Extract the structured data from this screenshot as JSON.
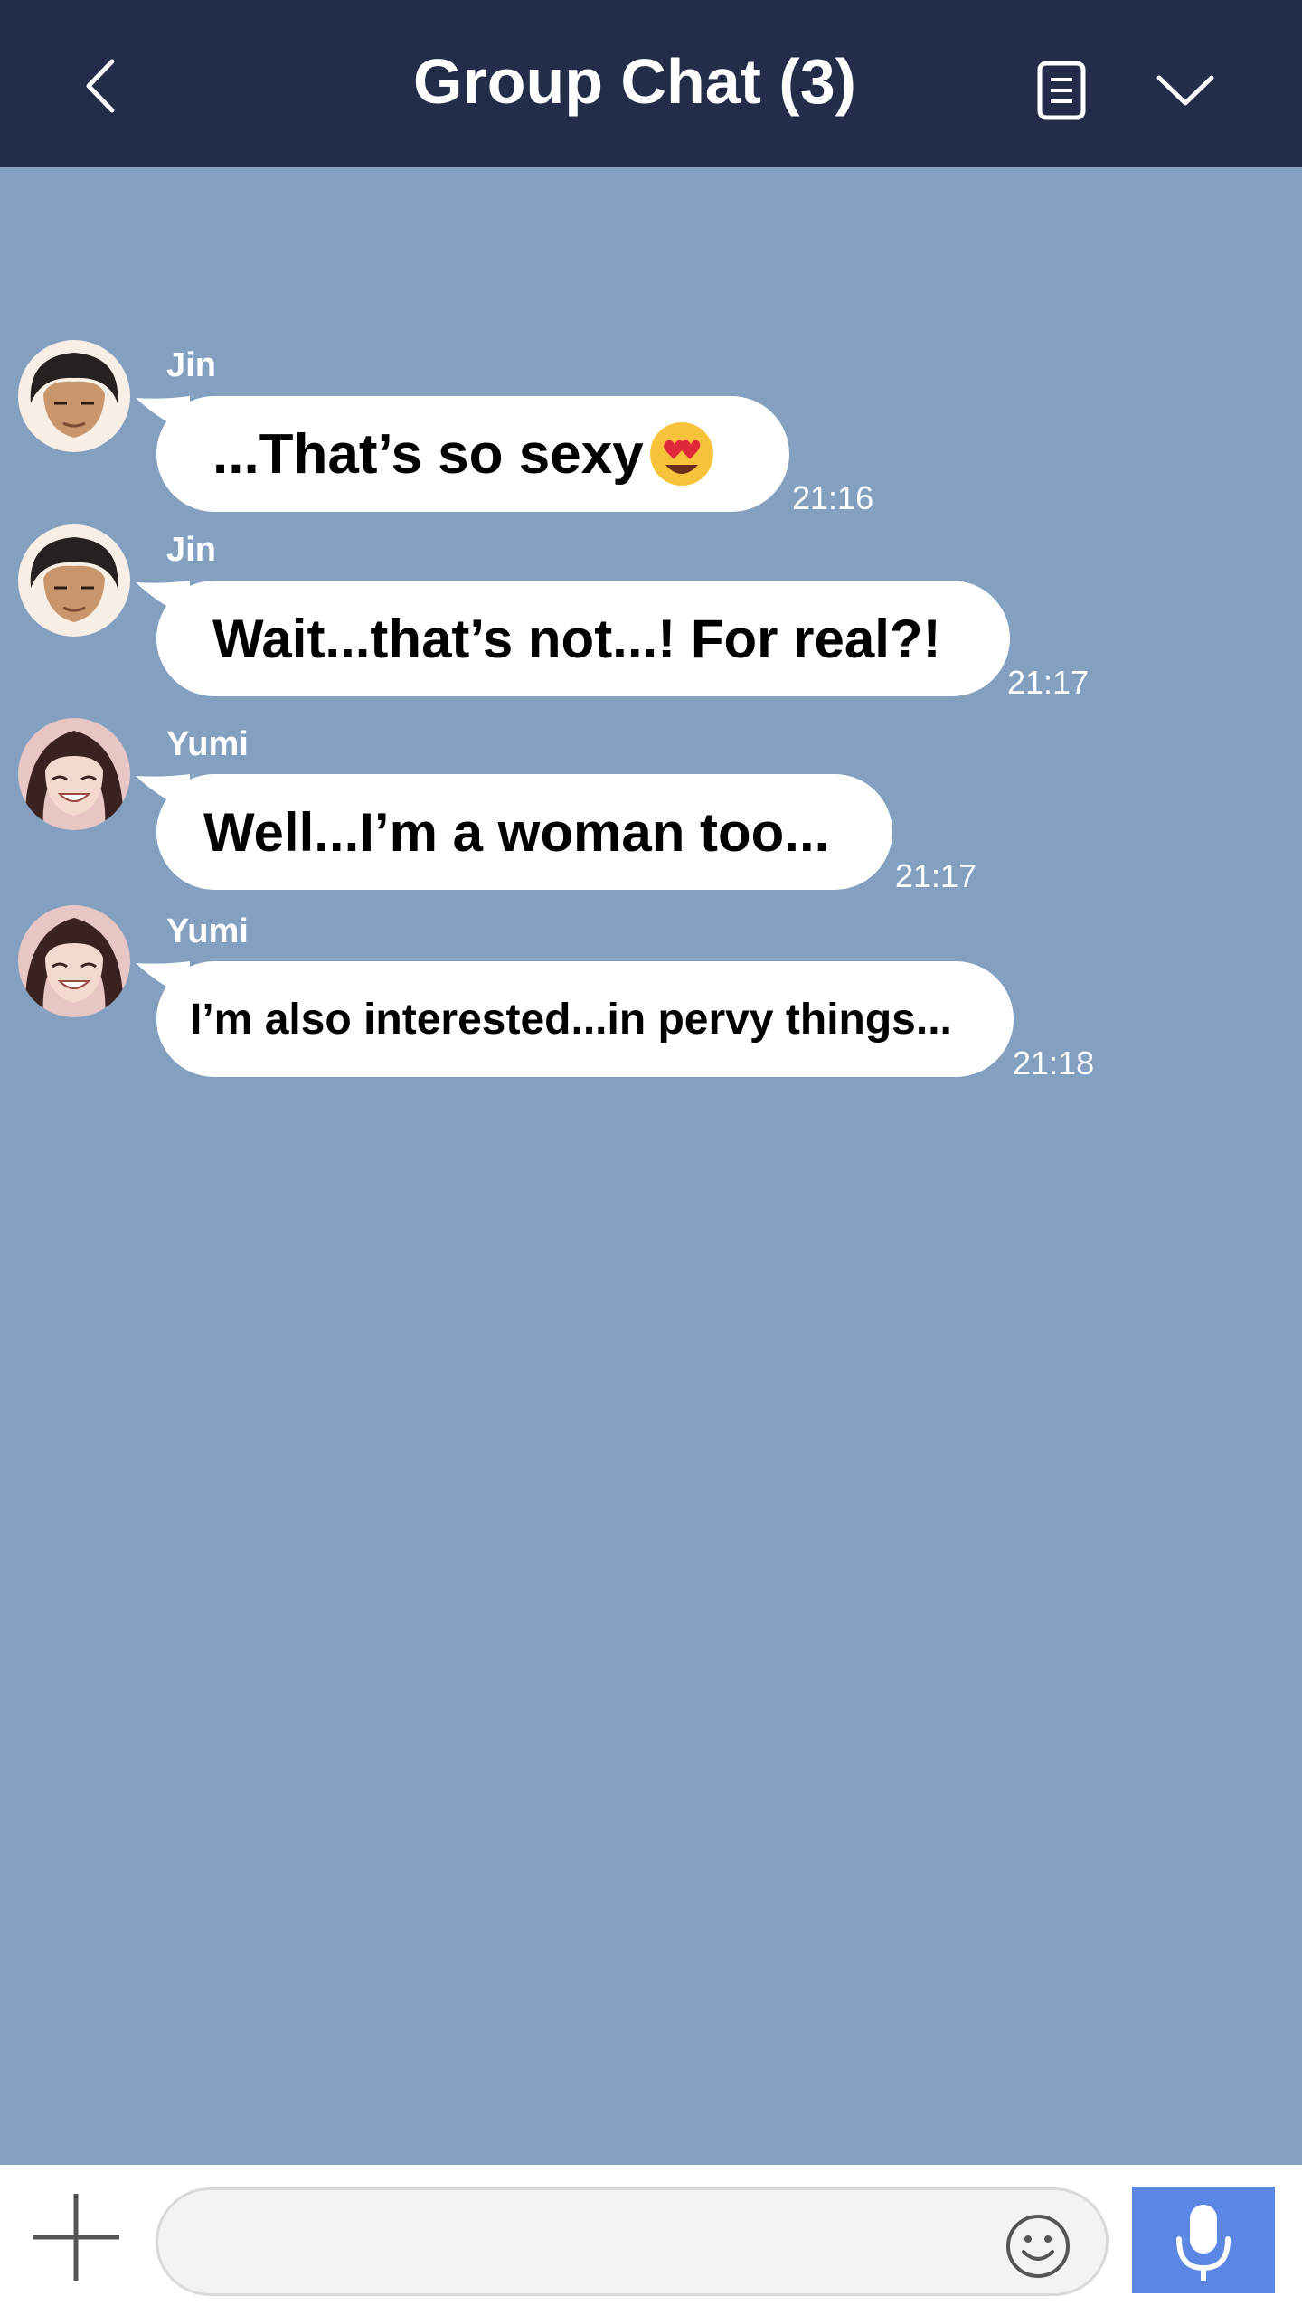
{
  "header": {
    "title": "Group Chat (3)",
    "back_icon": "chevron-left-icon",
    "notes_icon": "notes-icon",
    "menu_icon": "chevron-down-icon",
    "background": "#232c48"
  },
  "chat": {
    "background": "#84a0c1",
    "messages": [
      {
        "sender": "Jin",
        "text": "...That’s so sexy",
        "emoji": "heart-eyes-emoji",
        "time": "21:16"
      },
      {
        "sender": "Jin",
        "text": "Wait...that’s not...! For real?!",
        "time": "21:17"
      },
      {
        "sender": "Yumi",
        "text": "Well...I’m a woman too...",
        "time": "21:17"
      },
      {
        "sender": "Yumi",
        "text": "I’m also interested...in pervy things...",
        "time": "21:18"
      }
    ]
  },
  "composer": {
    "plus_icon": "plus-icon",
    "input_value": "",
    "emoji_icon": "smiley-icon",
    "mic_icon": "microphone-icon",
    "mic_color": "#5c86e3"
  }
}
